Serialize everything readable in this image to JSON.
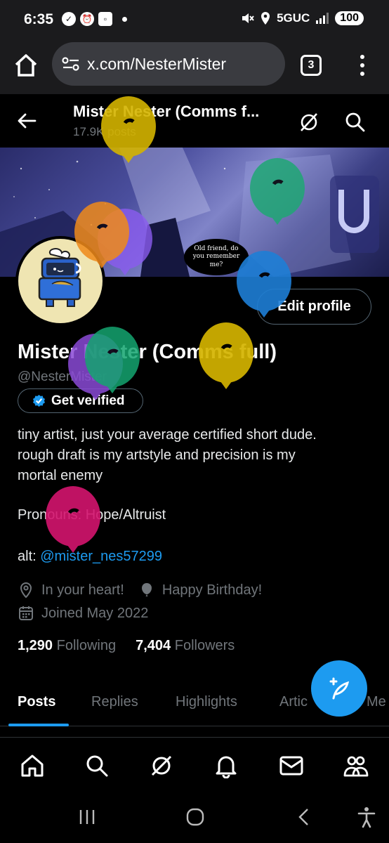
{
  "status_bar": {
    "time": "6:35",
    "network": "5GUC",
    "battery": "100"
  },
  "browser": {
    "url": "x.com/NesterMister",
    "tab_count": "3"
  },
  "header": {
    "title": "Mister Nester (Comms f...",
    "post_count": "17.9K posts"
  },
  "banner": {
    "speech_bubble": "Old friend, do you remember me?"
  },
  "profile": {
    "edit_label": "Edit profile",
    "name": "Mister Nester (Comms full)",
    "handle": "@NesterMister",
    "verify_label": "Get verified",
    "bio_line1": "tiny artist, just your average certified short dude.",
    "bio_line2": "rough draft is my artstyle and precision is my",
    "bio_line3": "mortal enemy",
    "pronouns": "Pronouns: Hope/Altruist",
    "alt_prefix": "alt: ",
    "alt_link": "@mister_nes57299",
    "location": "In your heart!",
    "birthday": "Happy Birthday!",
    "joined": "Joined May 2022",
    "following_count": "1,290",
    "following_label": "Following",
    "followers_count": "7,404",
    "followers_label": "Followers"
  },
  "tabs": [
    {
      "label": "Posts"
    },
    {
      "label": "Replies"
    },
    {
      "label": "Highlights"
    },
    {
      "label": "Artic"
    },
    {
      "label": "Me"
    }
  ],
  "colors": {
    "accent": "#1d9bf0",
    "background": "#000000",
    "muted": "#71767b"
  },
  "bottom_nav": [
    "home-icon",
    "search-icon",
    "grok-icon",
    "notifications-icon",
    "messages-icon",
    "communities-icon"
  ],
  "system_nav": [
    "recents-icon",
    "home-circle-icon",
    "back-icon",
    "accessibility-icon"
  ]
}
